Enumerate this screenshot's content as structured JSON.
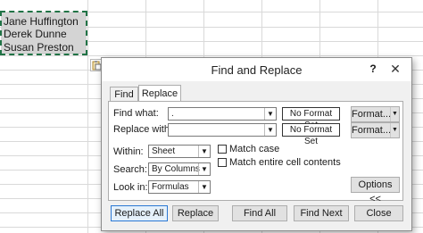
{
  "spreadsheet": {
    "cells": [
      "Jane Huffington",
      "Derek Dunne",
      "Susan Preston"
    ]
  },
  "dialog": {
    "title": "Find and Replace",
    "help": "?",
    "close_glyph": "✕",
    "tabs": [
      {
        "label": "Find",
        "selected": false
      },
      {
        "label": "Replace",
        "selected": true
      }
    ],
    "find_what": {
      "label": "Find what:",
      "value": "."
    },
    "replace_with": {
      "label": "Replace with:",
      "value": ""
    },
    "format_set_label": "No Format Set",
    "format_button_label": "Format...",
    "within": {
      "label": "Within:",
      "value": "Sheet"
    },
    "search": {
      "label": "Search:",
      "value": "By Columns"
    },
    "look_in": {
      "label": "Look in:",
      "value": "Formulas"
    },
    "match_case": {
      "label": "Match case",
      "checked": false
    },
    "match_entire": {
      "label": "Match entire cell contents",
      "checked": false
    },
    "options_button": "Options <<",
    "buttons": {
      "replace_all": "Replace All",
      "replace": "Replace",
      "find_all": "Find All",
      "find_next": "Find Next",
      "close": "Close"
    }
  }
}
